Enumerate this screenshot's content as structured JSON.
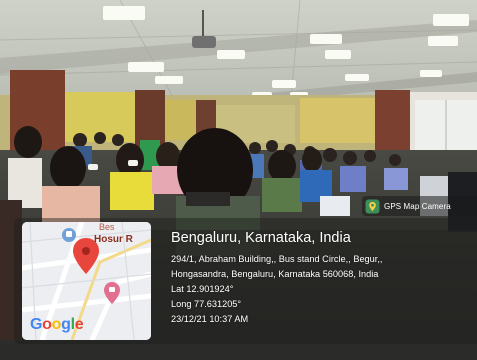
{
  "scene": {
    "description_icons": [
      "projector-icon",
      "ceiling-light-icon"
    ]
  },
  "badge": {
    "label": "GPS Map Camera",
    "icon": "gps-map-camera-icon"
  },
  "map": {
    "place_label": "Hosur R",
    "place_label_faint": "Bes",
    "logo": [
      "G",
      "o",
      "o",
      "g",
      "l",
      "e"
    ],
    "logo_colors": [
      "#4285F4",
      "#EA4335",
      "#FBBC05",
      "#4285F4",
      "#34A853",
      "#EA4335"
    ],
    "pin_color": "#e8453c",
    "poi_color": "#e26f8e",
    "transit_color": "#6fa0d8"
  },
  "location": {
    "title": "Bengaluru, Karnataka, India",
    "address_line1": "294/1, Abraham Building,, Bus stand Circle,, Begur,,",
    "address_line2": "Hongasandra, Bengaluru, Karnataka 560068, India",
    "lat": "Lat 12.901924°",
    "long": "Long 77.631205°",
    "datetime": "23/12/21 10:37 AM"
  }
}
